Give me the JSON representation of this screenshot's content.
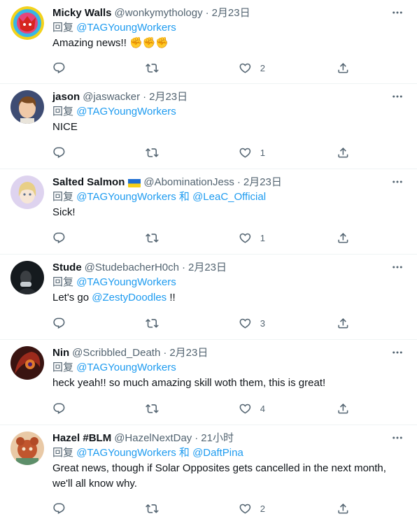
{
  "ui": {
    "reply_prefix": "回复",
    "and": "和"
  },
  "tweets": [
    {
      "name": "Micky Walls",
      "handle": "@wonkymythology",
      "time": "2月23日",
      "mentions": [
        "@TAGYoungWorkers"
      ],
      "text": "Amazing news!! ",
      "emoji": "✊✊✊",
      "likes": "2"
    },
    {
      "name": "jason",
      "handle": "@jaswacker",
      "time": "2月23日",
      "mentions": [
        "@TAGYoungWorkers"
      ],
      "text": "NICE",
      "likes": "1"
    },
    {
      "name": "Salted Salmon",
      "flag": "ukraine-flag",
      "handle": "@AbominationJess",
      "time": "2月23日",
      "mentions": [
        "@TAGYoungWorkers",
        "@LeaC_Official"
      ],
      "text": "Sick!",
      "likes": "1"
    },
    {
      "name": "Stude",
      "handle": "@StudebacherH0ch",
      "time": "2月23日",
      "mentions": [
        "@TAGYoungWorkers"
      ],
      "text_pre": "Let's go ",
      "text_mention": "@ZestyDoodles",
      "text_post": " !!",
      "likes": "3"
    },
    {
      "name": "Nin",
      "handle": "@Scribbled_Death",
      "time": "2月23日",
      "mentions": [
        "@TAGYoungWorkers"
      ],
      "text": "heck yeah!! so much amazing skill woth them, this is great!",
      "likes": "4"
    },
    {
      "name": "Hazel #BLM",
      "handle": "@HazelNextDay",
      "time": "21小时",
      "mentions": [
        "@TAGYoungWorkers",
        "@DaftPina"
      ],
      "text": "Great news, though if Solar Opposites gets cancelled in the next month, we'll all know why.",
      "likes": "2"
    }
  ],
  "colors": {
    "accent": "#1d9bf0",
    "secondary": "#536471",
    "text": "#0f1419",
    "divider": "#eff3f4"
  },
  "icons": [
    "reply-icon",
    "retweet-icon",
    "like-icon",
    "share-icon",
    "more-icon"
  ]
}
